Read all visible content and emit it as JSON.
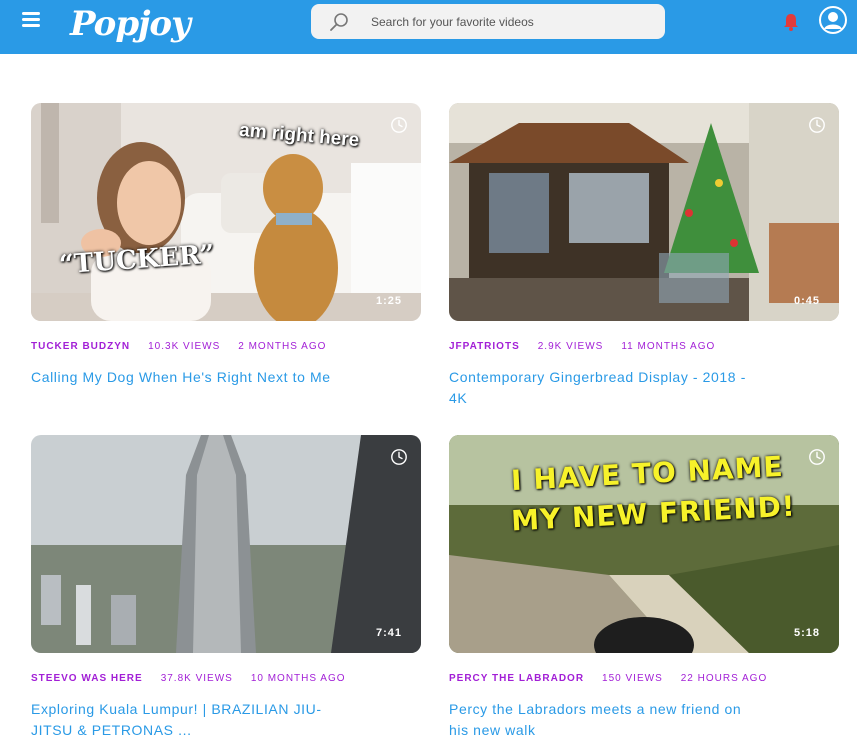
{
  "header": {
    "logo": "Popjoy",
    "search_placeholder": "Search for your favorite videos",
    "bar_color": "#2a9ae6",
    "bell_color": "#e23b3b"
  },
  "videos": [
    {
      "channel": "TUCKER BUDZYN",
      "views": "10.3K VIEWS",
      "ago": "2 MONTHS AGO",
      "title": "Calling My Dog When He's Right Next to Me",
      "duration": "1:25",
      "overlay_top": "am right here",
      "overlay_bottom": "“TUCKER”"
    },
    {
      "channel": "JFPATRIOTS",
      "views": "2.9K VIEWS",
      "ago": "11 MONTHS AGO",
      "title": "Contemporary Gingerbread Display - 2018 - 4K",
      "duration": "0:45"
    },
    {
      "channel": "STEEVO WAS HERE",
      "views": "37.8K VIEWS",
      "ago": "10 MONTHS AGO",
      "title": "Exploring Kuala Lumpur! | BRAZILIAN JIU-JITSU & PETRONAS ...",
      "duration": "7:41"
    },
    {
      "channel": "PERCY THE LABRADOR",
      "views": "150 VIEWS",
      "ago": "22 HOURS AGO",
      "title": "Percy the Labradors meets a new friend on his new walk",
      "duration": "5:18",
      "overlay_line1": "I HAVE TO NAME",
      "overlay_line2": "MY NEW FRIEND!"
    }
  ]
}
